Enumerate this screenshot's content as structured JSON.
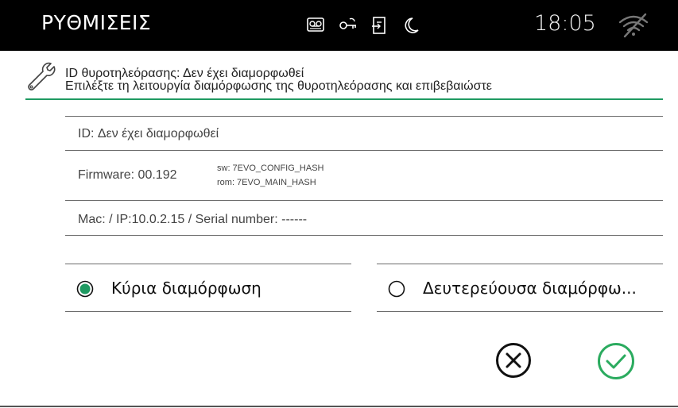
{
  "topbar": {
    "title": "ΡΥΘΜΙΣΕΙΣ",
    "time": "18:05",
    "status_icons": [
      "voicemail-icon",
      "key-icon",
      "door-exit-icon",
      "moon-icon"
    ],
    "wifi_icon": "wifi-off-icon"
  },
  "header": {
    "line1": "ID θυροτηλεόρασης: Δεν έχει διαμορφωθεί",
    "line2": "Επιλέξτε τη λειτουργία διαμόρφωσης της θυροτηλεόρασης και επιβεβαιώστε",
    "accent_color": "#1f9a62"
  },
  "info": {
    "id_text": "ID: Δεν έχει διαμορφωθεί",
    "firmware": "Firmware: 00.192",
    "sw": "sw: 7EVO_CONFIG_HASH",
    "rom": "rom: 7EVO_MAIN_HASH",
    "network": "Mac:  / IP:10.0.2.15 / Serial number: ------"
  },
  "options": {
    "primary_label": "Κύρια διαμόρφωση",
    "primary_selected": true,
    "secondary_label": "Δευτερεύουσα διαμόρφω...",
    "secondary_selected": false
  },
  "actions": {
    "cancel_icon": "cancel-circle-icon",
    "confirm_icon": "confirm-check-icon",
    "confirm_color": "#2bab5f"
  }
}
